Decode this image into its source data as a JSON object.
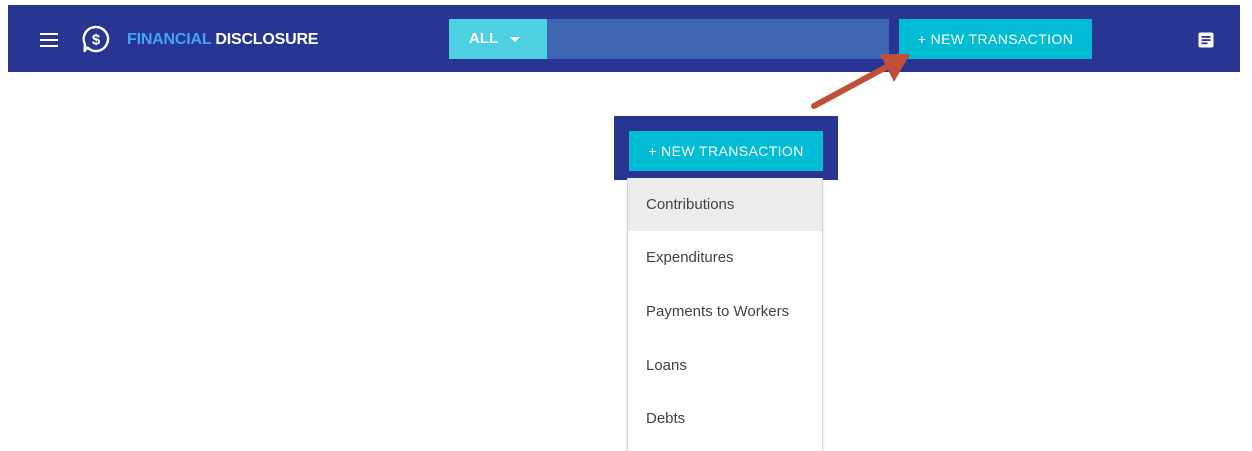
{
  "header": {
    "brand_accent": "FINANCIAL",
    "brand_main": " DISCLOSURE",
    "filter_value": "ALL",
    "search_placeholder": "",
    "new_transaction_label": "+ NEW TRANSACTION",
    "icons": [
      "menu-icon",
      "dollar-logo-icon",
      "chevron-down-icon",
      "notes-icon"
    ]
  },
  "callout": {
    "new_transaction_label": "+ NEW TRANSACTION",
    "menu_items": [
      {
        "label": "Contributions",
        "highlighted": true
      },
      {
        "label": "Expenditures",
        "highlighted": false
      },
      {
        "label": "Payments to Workers",
        "highlighted": false
      },
      {
        "label": "Loans",
        "highlighted": false
      },
      {
        "label": "Debts",
        "highlighted": false
      }
    ]
  },
  "colors": {
    "navbar": "#283593",
    "brand_accent": "#42a5f5",
    "button": "#00bcd4",
    "filter": "#4dd0e1",
    "search": "#3f66b3",
    "arrow": "#c0503a",
    "menu_highlight": "#ececec"
  }
}
